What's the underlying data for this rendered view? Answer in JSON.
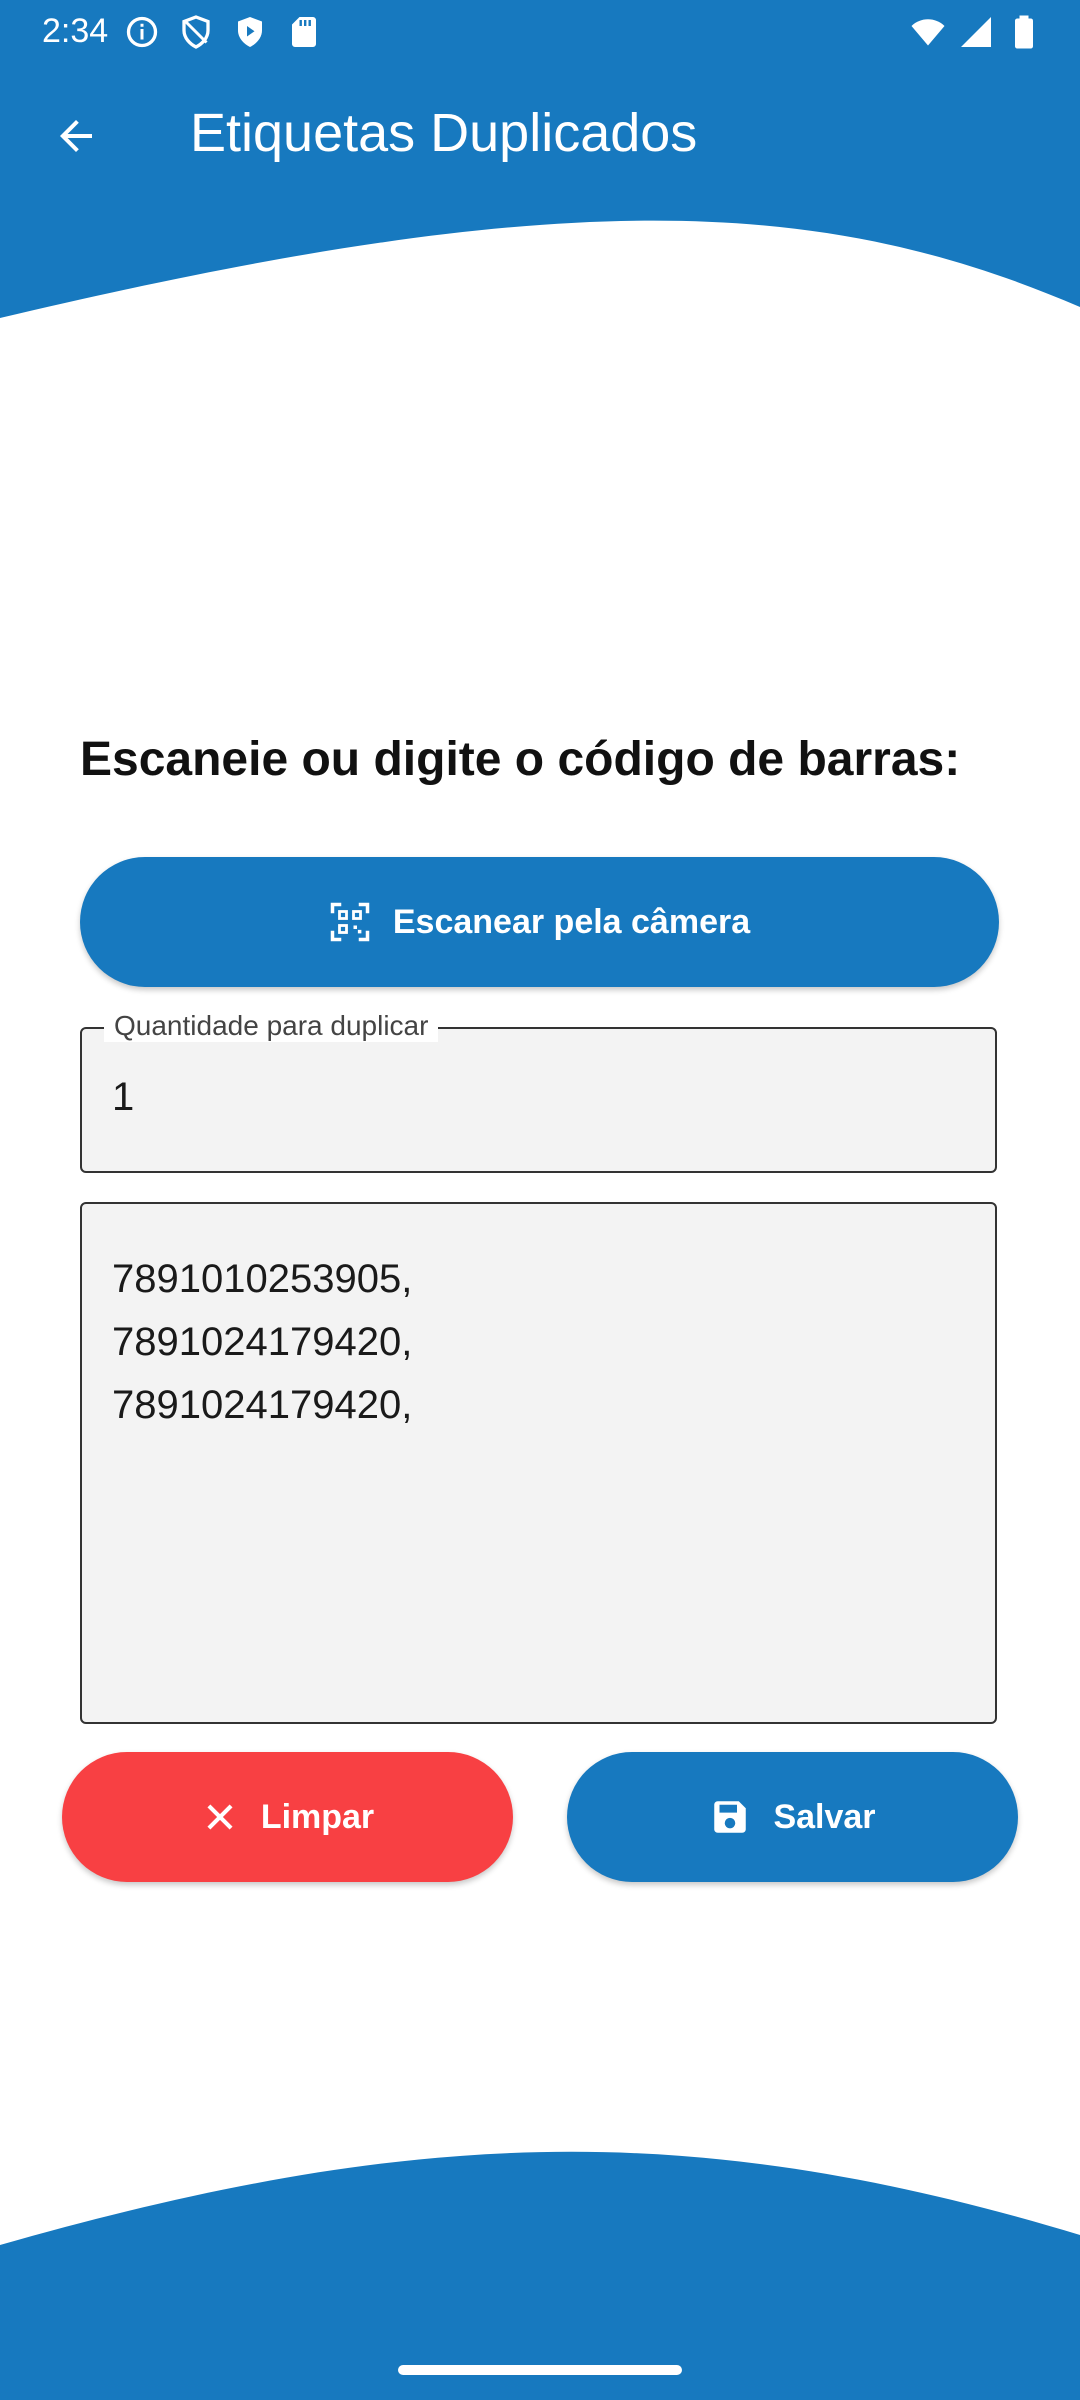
{
  "status_bar": {
    "time": "2:34",
    "left_icons": [
      "info-icon",
      "shield-icon",
      "play-protect-icon",
      "sd-card-icon"
    ],
    "right_icons": [
      "wifi-icon",
      "signal-icon",
      "battery-icon"
    ]
  },
  "app_bar": {
    "back_icon": "arrow-back-icon",
    "title": "Etiquetas Duplicados"
  },
  "main": {
    "heading": "Escaneie ou digite o código de barras:",
    "scan_button": {
      "icon": "qr-scan-icon",
      "label": "Escanear pela câmera"
    },
    "quantity_field": {
      "label": "Quantidade para duplicar",
      "value": "1"
    },
    "barcodes_text": "7891010253905,\n7891024179420,\n7891024179420,",
    "clear_button": {
      "icon": "close-icon",
      "label": "Limpar"
    },
    "save_button": {
      "icon": "save-icon",
      "label": "Salvar"
    }
  },
  "colors": {
    "primary": "#1779bf",
    "danger": "#f84043",
    "field_background": "#f3f3f3"
  }
}
